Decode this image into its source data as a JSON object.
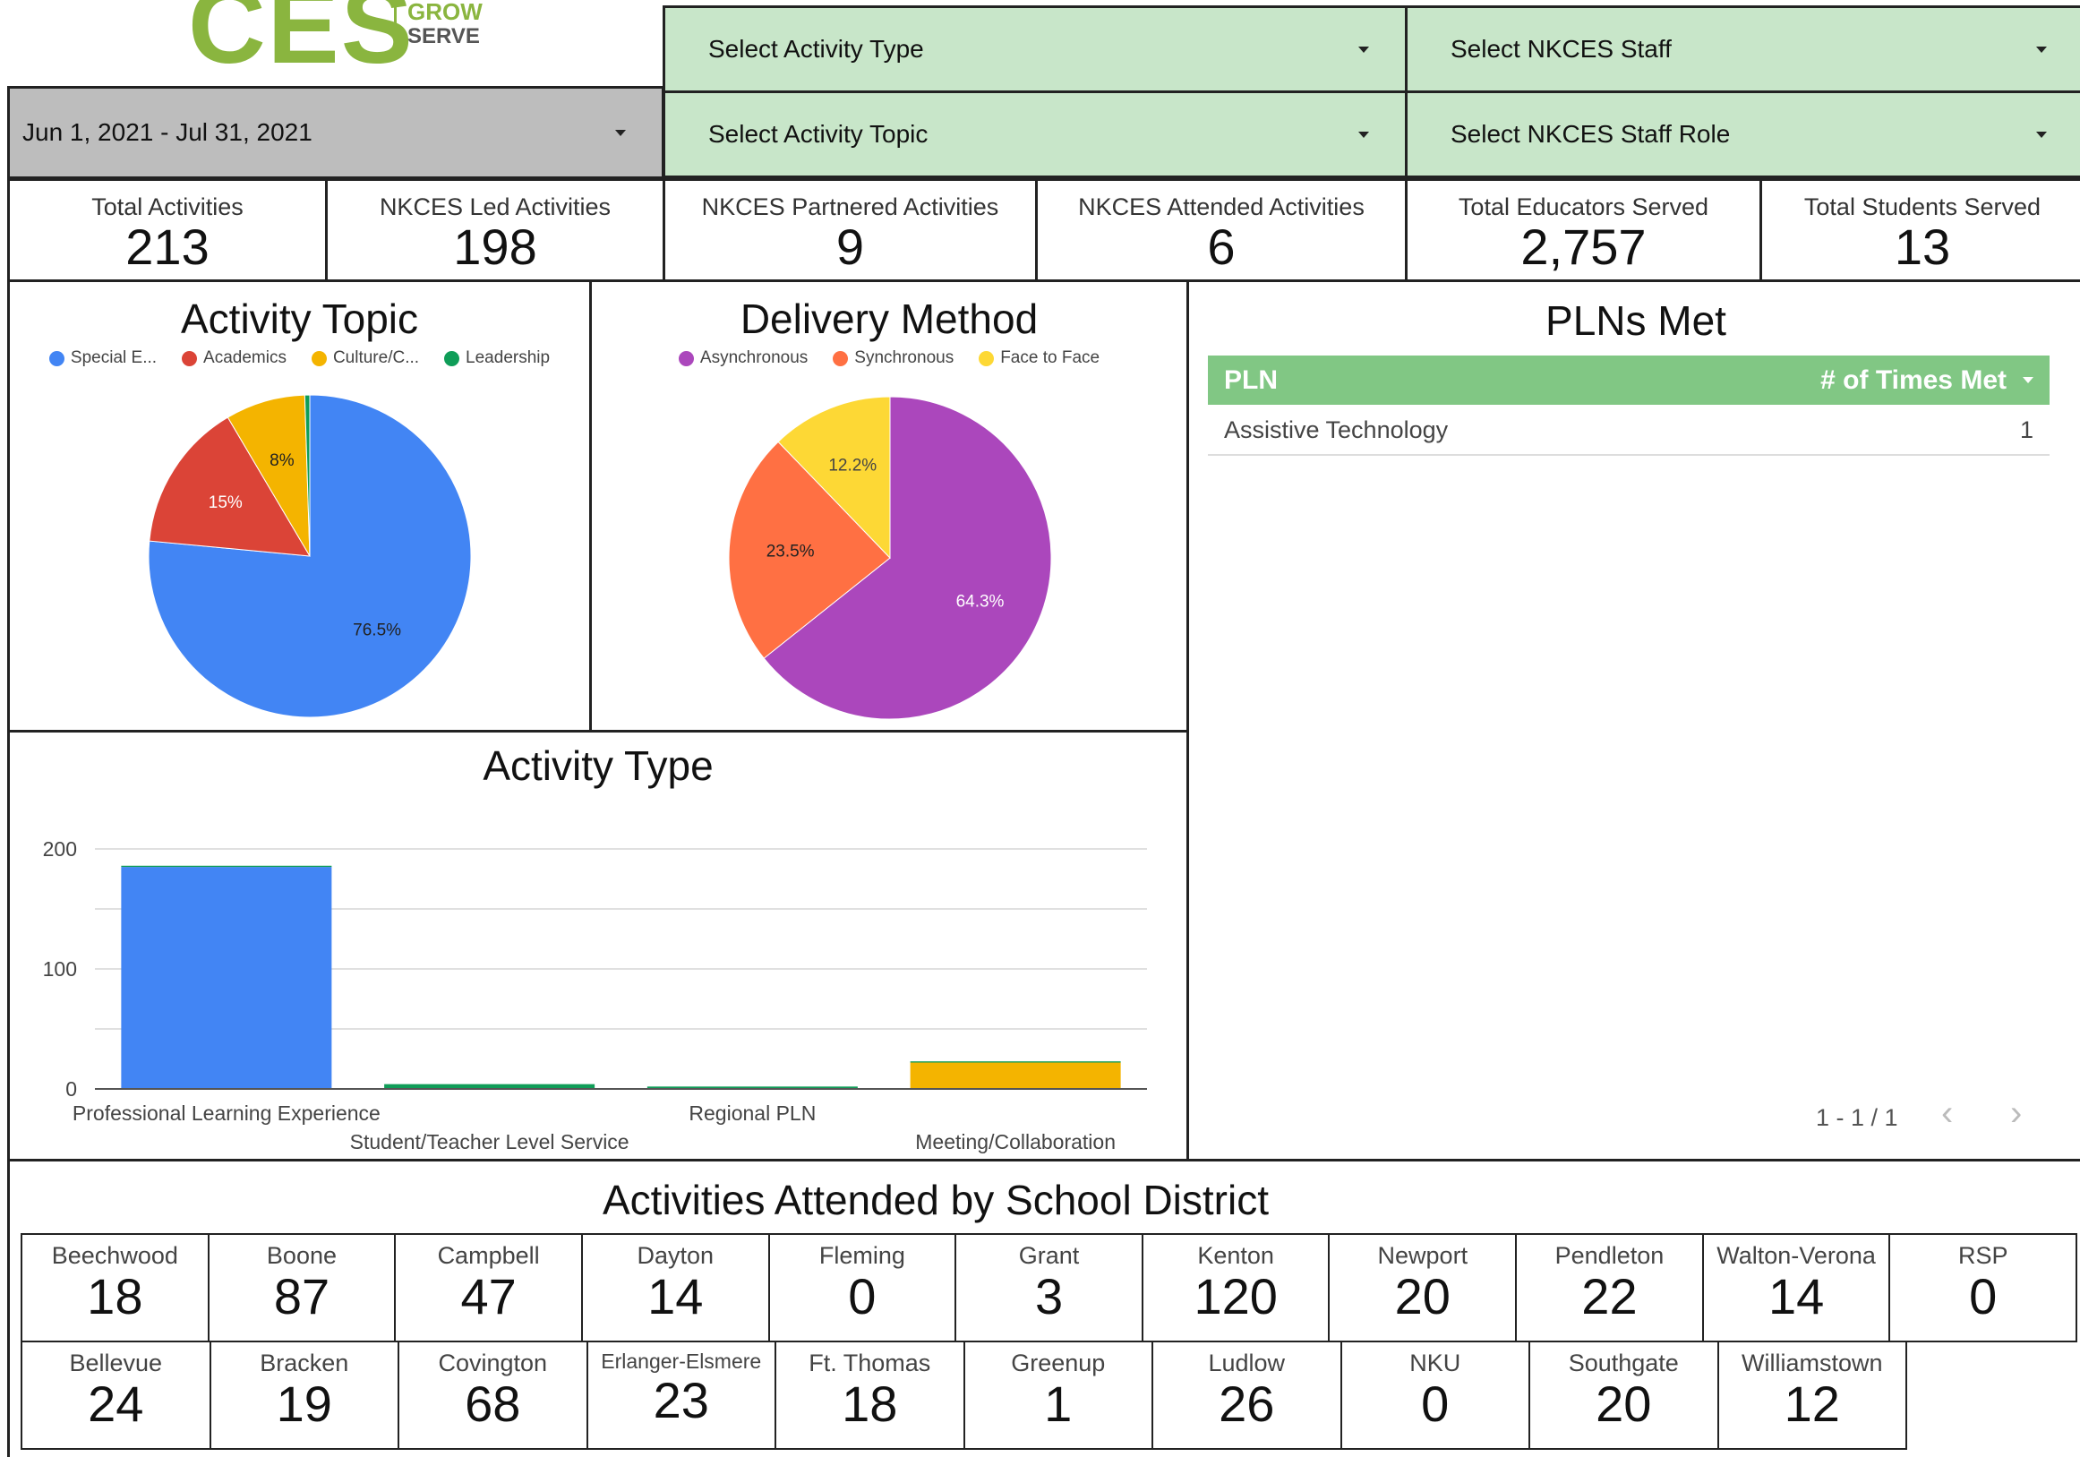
{
  "logo": {
    "text": "CES",
    "grow": "GROW",
    "serve": "SERVE"
  },
  "filters": {
    "date_range": "Jun 1, 2021 - Jul 31, 2021",
    "activity_type": "Select Activity Type",
    "activity_topic": "Select Activity Topic",
    "staff": "Select NKCES Staff",
    "staff_role": "Select NKCES Staff Role"
  },
  "kpis": [
    {
      "label": "Total Activities",
      "value": "213"
    },
    {
      "label": "NKCES Led Activities",
      "value": "198"
    },
    {
      "label": "NKCES Partnered Activities",
      "value": "9"
    },
    {
      "label": "NKCES Attended Activities",
      "value": "6"
    },
    {
      "label": "Total Educators Served",
      "value": "2,757"
    },
    {
      "label": "Total Students Served",
      "value": "13"
    }
  ],
  "colors": {
    "blue": "#4285f4",
    "red": "#db4437",
    "amber": "#f4b400",
    "green": "#0f9d58",
    "purple": "#ab47bc",
    "orange": "#ff7043",
    "yellow": "#fdd835",
    "header_green": "#81c784",
    "filter_green": "#c8e6c9"
  },
  "chart_data": [
    {
      "type": "pie",
      "title": "Activity Topic",
      "legend": [
        "Special E...",
        "Academics",
        "Culture/C...",
        "Leadership"
      ],
      "slices": [
        {
          "name": "Special E...",
          "value": 76.5,
          "label": "76.5%"
        },
        {
          "name": "Academics",
          "value": 15,
          "label": "15%"
        },
        {
          "name": "Culture/C...",
          "value": 8,
          "label": "8%"
        },
        {
          "name": "Leadership",
          "value": 0.5,
          "label": ""
        }
      ],
      "legend_position": "top"
    },
    {
      "type": "pie",
      "title": "Delivery Method",
      "legend": [
        "Asynchronous",
        "Synchronous",
        "Face to Face"
      ],
      "slices": [
        {
          "name": "Asynchronous",
          "value": 64.3,
          "label": "64.3%"
        },
        {
          "name": "Synchronous",
          "value": 23.5,
          "label": "23.5%"
        },
        {
          "name": "Face to Face",
          "value": 12.2,
          "label": "12.2%"
        }
      ],
      "legend_position": "top"
    },
    {
      "type": "bar",
      "title": "Activity Type",
      "categories": [
        "Professional Learning Experience",
        "Student/Teacher Level Service",
        "Regional PLN",
        "Meeting/Collaboration"
      ],
      "series": [
        {
          "values": [
            185,
            4,
            2,
            22
          ]
        },
        {
          "values": [
            1,
            0,
            0,
            1
          ]
        }
      ],
      "yticks": [
        0,
        100,
        200
      ],
      "ylim": [
        0,
        200
      ],
      "grid": true,
      "stacked": true
    }
  ],
  "pln_table": {
    "title": "PLNs Met",
    "col1": "PLN",
    "col2": "# of Times Met",
    "rows": [
      {
        "name": "Assistive Technology",
        "count": "1"
      }
    ],
    "pagination": "1 - 1 / 1"
  },
  "district_title": "Activities Attended by School District",
  "districts_row1": [
    {
      "name": "Beechwood",
      "value": "18"
    },
    {
      "name": "Boone",
      "value": "87"
    },
    {
      "name": "Campbell",
      "value": "47"
    },
    {
      "name": "Dayton",
      "value": "14"
    },
    {
      "name": "Fleming",
      "value": "0"
    },
    {
      "name": "Grant",
      "value": "3"
    },
    {
      "name": "Kenton",
      "value": "120"
    },
    {
      "name": "Newport",
      "value": "20"
    },
    {
      "name": "Pendleton",
      "value": "22"
    },
    {
      "name": "Walton-Verona",
      "value": "14"
    },
    {
      "name": "RSP",
      "value": "0"
    }
  ],
  "districts_row2": [
    {
      "name": "Bellevue",
      "value": "24"
    },
    {
      "name": "Bracken",
      "value": "19"
    },
    {
      "name": "Covington",
      "value": "68"
    },
    {
      "name": "Erlanger-Elsmere",
      "value": "23"
    },
    {
      "name": "Ft. Thomas",
      "value": "18"
    },
    {
      "name": "Greenup",
      "value": "1"
    },
    {
      "name": "Ludlow",
      "value": "26"
    },
    {
      "name": "NKU",
      "value": "0"
    },
    {
      "name": "Southgate",
      "value": "20"
    },
    {
      "name": "Williamstown",
      "value": "12"
    }
  ]
}
